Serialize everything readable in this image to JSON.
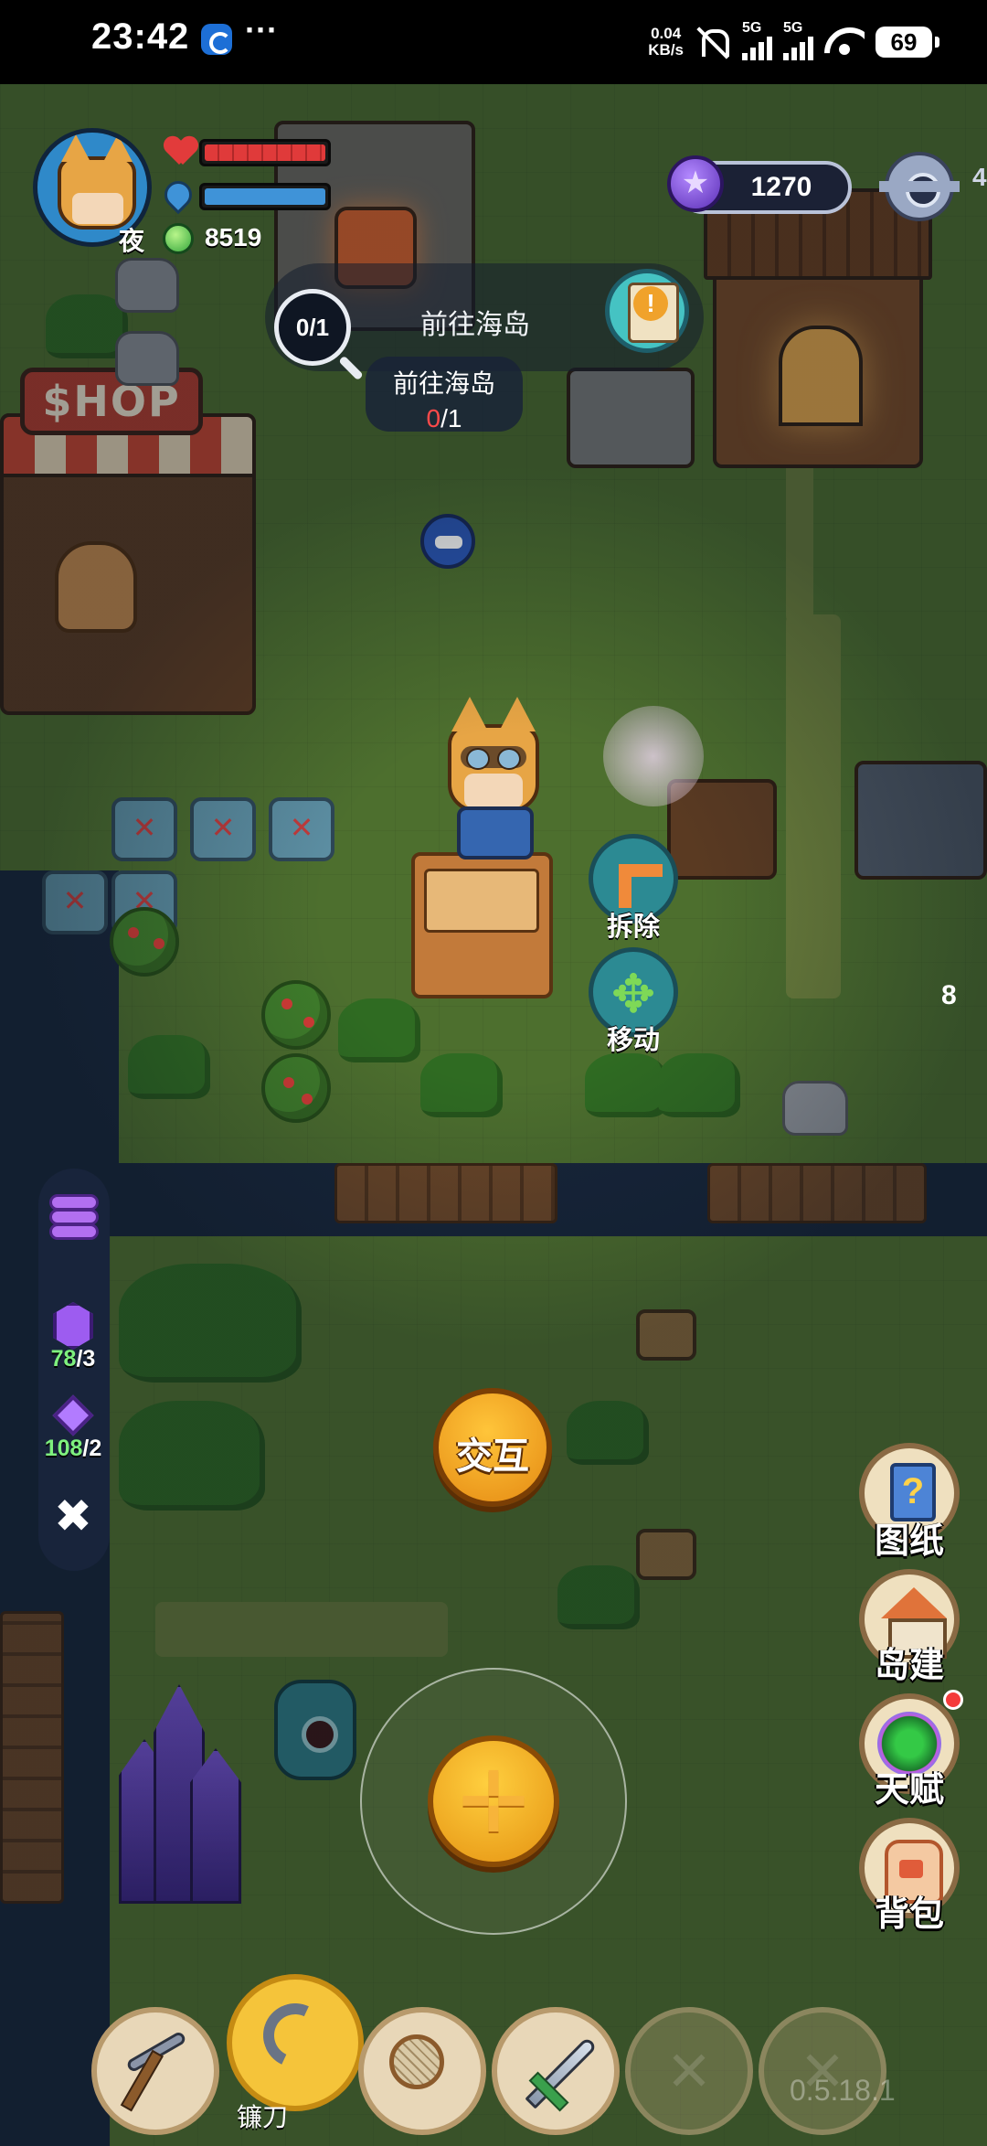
{
  "status_bar": {
    "time": "23:42",
    "more": "···",
    "speed_value": "0.04",
    "speed_unit": "KB/s",
    "network_1": "5G",
    "network_2": "5G",
    "battery": "69"
  },
  "player": {
    "name_char": "夜",
    "hp_fraction": 1.0,
    "mp_fraction": 1.0,
    "gems": "8519"
  },
  "currency": {
    "value": "1270",
    "icon": "star-coin-icon"
  },
  "edge_number": "4",
  "quest": {
    "progress_badge": "0/1",
    "title": "前往海岛",
    "popup_title": "前往海岛",
    "popup_current": "0",
    "popup_total": "/1"
  },
  "shop_sign": "$HOP",
  "actions": {
    "remove": "拆除",
    "move": "移动",
    "interact": "交互"
  },
  "side_number": "8",
  "left_rail": {
    "crystal_count": "78",
    "crystal_total": "/3",
    "diamond_count": "108",
    "diamond_total": "/2"
  },
  "right_menu": [
    {
      "label": "图纸",
      "icon": "blueprint-icon"
    },
    {
      "label": "岛建",
      "icon": "island-build-icon"
    },
    {
      "label": "天赋",
      "icon": "talent-icon"
    },
    {
      "label": "背包",
      "icon": "backpack-icon"
    }
  ],
  "toolbar": {
    "selected_label": "镰刀",
    "items": [
      "pickaxe-icon",
      "sickle-icon",
      "net-icon",
      "sword-icon",
      "locked-slot-icon",
      "locked-slot-icon"
    ]
  },
  "version": "0.5.18.1",
  "colors": {
    "hp": "#e03a3a",
    "mp": "#3f93d8",
    "accent_gold": "#f5c43a",
    "quest_red": "#ff4a4a"
  }
}
